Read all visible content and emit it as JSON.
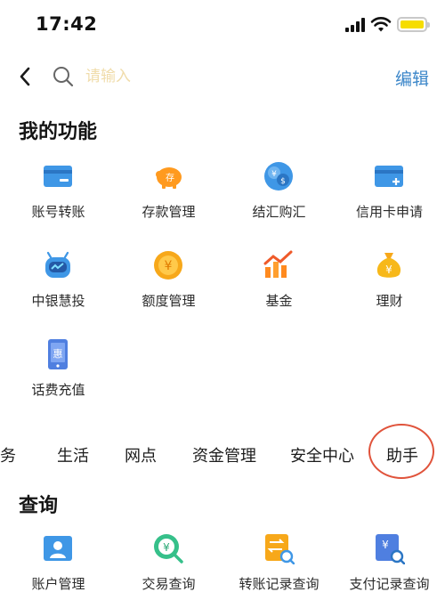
{
  "status_bar": {
    "time": "17:42"
  },
  "search": {
    "placeholder": "请输入"
  },
  "header": {
    "edit_label": "编辑"
  },
  "my_functions": {
    "title": "我的功能",
    "items": [
      {
        "label": "账号转账",
        "icon": "card-transfer-icon"
      },
      {
        "label": "存款管理",
        "icon": "piggy-bank-icon"
      },
      {
        "label": "结汇购汇",
        "icon": "currency-exchange-icon"
      },
      {
        "label": "信用卡申请",
        "icon": "credit-card-add-icon"
      },
      {
        "label": "中银慧投",
        "icon": "robot-advisor-icon"
      },
      {
        "label": "额度管理",
        "icon": "quota-coin-icon"
      },
      {
        "label": "基金",
        "icon": "fund-chart-icon"
      },
      {
        "label": "理财",
        "icon": "money-bag-icon"
      },
      {
        "label": "话费充值",
        "icon": "phone-topup-icon"
      }
    ]
  },
  "tabs": [
    {
      "label": "服务"
    },
    {
      "label": "生活"
    },
    {
      "label": "网点"
    },
    {
      "label": "资金管理"
    },
    {
      "label": "安全中心"
    },
    {
      "label": "助手"
    }
  ],
  "query": {
    "title": "查询",
    "items": [
      {
        "label": "账户管理",
        "icon": "account-user-icon"
      },
      {
        "label": "交易查询",
        "icon": "transaction-search-icon"
      },
      {
        "label": "转账记录查询",
        "icon": "transfer-record-icon"
      },
      {
        "label": "支付记录查询",
        "icon": "payment-record-icon"
      }
    ]
  },
  "colors": {
    "accent_blue": "#3b86c9",
    "orange": "#ff9a1f",
    "yellow": "#f7c21a",
    "highlight_circle": "#e0533b",
    "battery": "#f6dd00"
  }
}
